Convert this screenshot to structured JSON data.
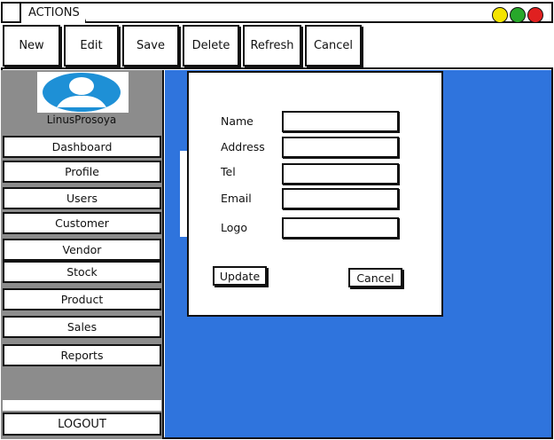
{
  "window": {
    "tab_label": "ACTIONS"
  },
  "toolbar": {
    "buttons": [
      {
        "label": "New"
      },
      {
        "label": "Edit"
      },
      {
        "label": "Save"
      },
      {
        "label": "Delete"
      },
      {
        "label": "Refresh"
      },
      {
        "label": "Cancel"
      }
    ]
  },
  "sidebar": {
    "username": "LinusProsoya",
    "items": [
      {
        "label": "Dashboard"
      },
      {
        "label": "Profile"
      },
      {
        "label": "Users"
      },
      {
        "label": "Customer"
      },
      {
        "label": "Vendor"
      },
      {
        "label": "Stock"
      },
      {
        "label": "Product"
      },
      {
        "label": "Sales"
      },
      {
        "label": "Reports"
      }
    ],
    "logout_label": "LOGOUT"
  },
  "form": {
    "fields": [
      {
        "label": "Name",
        "value": ""
      },
      {
        "label": "Address",
        "value": ""
      },
      {
        "label": "Tel",
        "value": ""
      },
      {
        "label": "Email",
        "value": ""
      },
      {
        "label": "Logo",
        "value": ""
      }
    ],
    "update_label": "Update",
    "cancel_label": "Cancel"
  },
  "colors": {
    "main_bg": "#2f74dd",
    "sidebar_bg": "#8c8c8c",
    "avatar": "#1e90d6",
    "traffic_yellow": "#f4e400",
    "traffic_green": "#27a82a",
    "traffic_red": "#e02020"
  }
}
